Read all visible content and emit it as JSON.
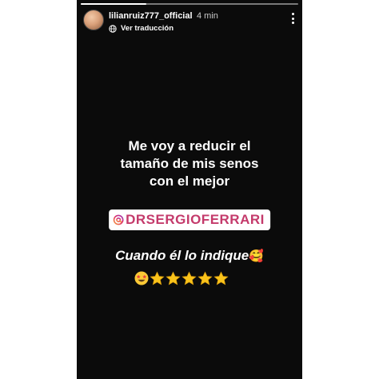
{
  "story": {
    "progress_fraction": 0.3,
    "username": "lilianruiz777_official",
    "time_ago": "4 min",
    "translate_label": "Ver traducción",
    "lines": [
      "Me voy a reducir  el",
      "tamaño de mis senos",
      "con el mejor"
    ],
    "mention": "DRSERGIOFERRARI",
    "closing_text": "Cuando él lo indique",
    "closing_emoji": "🥰",
    "rating_emoji": "🤩",
    "stars": 5,
    "icons": [
      "menu-dots-icon",
      "translate-icon",
      "mention-at-icon",
      "star-struck-icon",
      "star-icon"
    ],
    "colors": {
      "background": "#0b0b0b",
      "mention_text": "#c43a6b",
      "star": "#f9c31b"
    }
  }
}
